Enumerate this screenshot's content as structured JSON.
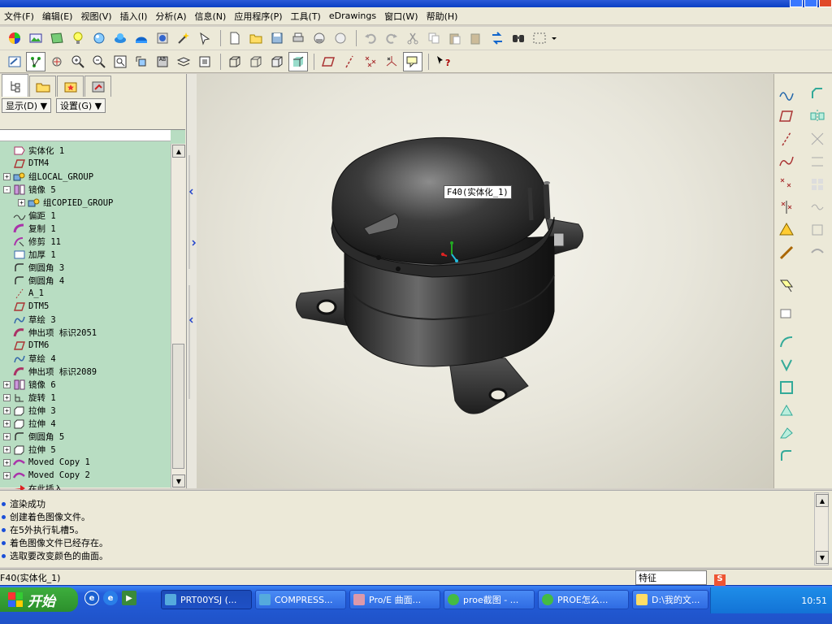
{
  "menubar": {
    "items": [
      "文件(F)",
      "编辑(E)",
      "视图(V)",
      "插入(I)",
      "分析(A)",
      "信息(N)",
      "应用程序(P)",
      "工具(T)",
      "eDrawings",
      "窗口(W)",
      "帮助(H)"
    ]
  },
  "toolbar1": {
    "icons": [
      "color-wheel-icon",
      "appearance-icon",
      "texture-icon",
      "light-icon",
      "scene-icon",
      "render-icon",
      "room-icon",
      "globe-icon",
      "magic-wand-icon",
      "new-file-icon",
      "open-folder-icon",
      "save-icon",
      "print-icon",
      "email-icon",
      "email-attach-icon",
      "undo-icon",
      "redo-icon",
      "cut-icon",
      "copy-icon",
      "paste-icon",
      "paste-special-icon",
      "regenerate-icon",
      "find-icon",
      "select-box-icon"
    ]
  },
  "toolbar2": {
    "icons": [
      "repaint-icon",
      "orient-icon",
      "spin-center-icon",
      "zoom-in-icon",
      "zoom-out-icon",
      "refit-icon",
      "reorient-icon",
      "saved-views-icon",
      "layers-icon",
      "view-manager-icon",
      "wireframe-icon",
      "hidden-line-icon",
      "no-hidden-icon",
      "shading-icon",
      "datum-planes-icon",
      "datum-axes-icon",
      "datum-points-icon",
      "datum-csys-icon",
      "annotations-icon",
      "whats-this-icon"
    ]
  },
  "nav": {
    "tabs": [
      "model-tree-tab",
      "folder-tab",
      "favorites-tab",
      "connections-tab"
    ],
    "show_btn": "显示(D)",
    "settings_btn": "设置(G)",
    "tree": [
      {
        "label": "实体化 1",
        "indent": 1,
        "icon": "solidify-icon",
        "exp": ""
      },
      {
        "label": "DTM4",
        "indent": 1,
        "icon": "datum-plane-icon",
        "exp": ""
      },
      {
        "label": "组LOCAL_GROUP",
        "indent": 1,
        "icon": "group-icon",
        "exp": "+"
      },
      {
        "label": "镜像 5",
        "indent": 1,
        "icon": "mirror-icon",
        "exp": "-"
      },
      {
        "label": "组COPIED_GROUP",
        "indent": 2,
        "icon": "group-icon",
        "exp": "+"
      },
      {
        "label": "偏距 1",
        "indent": 1,
        "icon": "offset-icon",
        "exp": ""
      },
      {
        "label": "复制 1",
        "indent": 1,
        "icon": "copy-surface-icon",
        "exp": ""
      },
      {
        "label": "修剪 11",
        "indent": 1,
        "icon": "trim-icon",
        "exp": ""
      },
      {
        "label": "加厚 1",
        "indent": 1,
        "icon": "thicken-icon",
        "exp": ""
      },
      {
        "label": "倒圆角 3",
        "indent": 1,
        "icon": "round-icon",
        "exp": ""
      },
      {
        "label": "倒圆角 4",
        "indent": 1,
        "icon": "round-icon",
        "exp": ""
      },
      {
        "label": "A_1",
        "indent": 1,
        "icon": "datum-axis-icon",
        "exp": ""
      },
      {
        "label": "DTM5",
        "indent": 1,
        "icon": "datum-plane-icon",
        "exp": ""
      },
      {
        "label": "草绘 3",
        "indent": 1,
        "icon": "sketch-icon",
        "exp": ""
      },
      {
        "label": "伸出项 标识2051",
        "indent": 1,
        "icon": "protrusion-icon",
        "exp": ""
      },
      {
        "label": "DTM6",
        "indent": 1,
        "icon": "datum-plane-icon",
        "exp": ""
      },
      {
        "label": "草绘 4",
        "indent": 1,
        "icon": "sketch-icon",
        "exp": ""
      },
      {
        "label": "伸出项 标识2089",
        "indent": 1,
        "icon": "protrusion-icon",
        "exp": ""
      },
      {
        "label": "镜像 6",
        "indent": 1,
        "icon": "mirror-icon",
        "exp": "+"
      },
      {
        "label": "旋转 1",
        "indent": 1,
        "icon": "revolve-icon",
        "exp": "+"
      },
      {
        "label": "拉伸 3",
        "indent": 1,
        "icon": "extrude-icon",
        "exp": "+"
      },
      {
        "label": "拉伸 4",
        "indent": 1,
        "icon": "extrude-icon",
        "exp": "+"
      },
      {
        "label": "倒圆角 5",
        "indent": 1,
        "icon": "round-icon",
        "exp": "+"
      },
      {
        "label": "拉伸 5",
        "indent": 1,
        "icon": "extrude-icon",
        "exp": "+"
      },
      {
        "label": "Moved Copy 1",
        "indent": 1,
        "icon": "moved-copy-icon",
        "exp": "+"
      },
      {
        "label": "Moved Copy 2",
        "indent": 1,
        "icon": "moved-copy-icon",
        "exp": "+"
      },
      {
        "label": "在此插入",
        "indent": 1,
        "icon": "insert-arrow-icon",
        "exp": ""
      }
    ]
  },
  "viewport": {
    "tooltip": "F40(实体化_1)"
  },
  "right_toolbar": {
    "icons": [
      "datum-curve-icon",
      "datum-plane-tool-icon",
      "datum-axis-tool-icon",
      "sketch-tool-icon",
      "datum-point-tool-icon",
      "csys-tool-icon",
      "analysis-icon",
      "sketched-datum-icon",
      "hole-icon",
      "extrude-tool-icon",
      "revolve-tool-icon",
      "sweep-icon",
      "shell-icon",
      "rib-icon",
      "draft-icon",
      "round-tool-icon",
      "chamfer-icon",
      "mirror-tool-icon",
      "merge-icon",
      "trim-tool-icon",
      "pattern-icon",
      "offset-tool-icon",
      "thicken-tool-icon",
      "solidify-tool-icon"
    ]
  },
  "messages": [
    "渲染成功",
    "创建着色图像文件。",
    "在5外执行轧槽5。",
    "着色图像文件已经存在。",
    "选取要改变颜色的曲面。"
  ],
  "status": {
    "left": "F40(实体化_1)",
    "filter": "特征"
  },
  "taskbar": {
    "start": "开始",
    "tasks": [
      "PRT00YSJ (...",
      "COMPRESS...",
      "Pro/E 曲面...",
      "proe截图 - ...",
      "PROE怎么...",
      "D:\\我的文..."
    ],
    "clock": "10:51"
  }
}
